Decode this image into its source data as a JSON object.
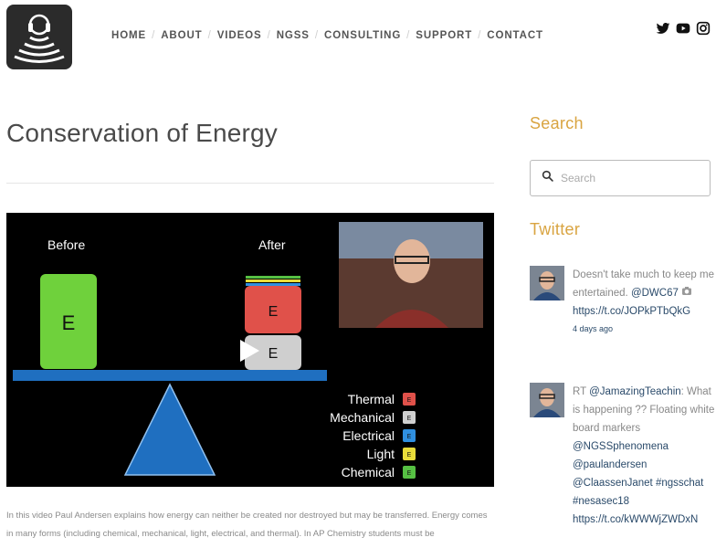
{
  "header": {
    "nav": [
      {
        "label": "HOME"
      },
      {
        "label": "ABOUT"
      },
      {
        "label": "VIDEOS"
      },
      {
        "label": "NGSS"
      },
      {
        "label": "CONSULTING"
      },
      {
        "label": "SUPPORT"
      },
      {
        "label": "CONTACT"
      }
    ],
    "social": [
      "twitter-icon",
      "youtube-icon",
      "instagram-icon"
    ]
  },
  "main": {
    "title": "Conservation of Energy",
    "video": {
      "before_label": "Before",
      "after_label": "After",
      "box_letter": "E",
      "legend": [
        {
          "label": "Thermal",
          "color": "#e0514a"
        },
        {
          "label": "Mechanical",
          "color": "#cfcfcf"
        },
        {
          "label": "Electrical",
          "color": "#2f8fe0"
        },
        {
          "label": "Light",
          "color": "#e8dc3a"
        },
        {
          "label": "Chemical",
          "color": "#56c043"
        }
      ]
    },
    "description": "In this video Paul Andersen explains how energy can neither be created nor destroyed but may be transferred. Energy comes in many forms (including chemical, mechanical, light, electrical, and thermal). In AP Chemistry students must be"
  },
  "sidebar": {
    "search_heading": "Search",
    "search_placeholder": "Search",
    "twitter_heading": "Twitter",
    "tweets": [
      {
        "text": "Doesn't take much to keep me entertained. ",
        "mention": "@DWC67",
        "link": "https://t.co/JOPkPTbQkG",
        "time": "4 days ago"
      },
      {
        "prefix": "RT ",
        "mention": "@JamazingTeachin",
        "text": ": What is happening ?? Floating white board markers",
        "mention2": "@NGSSphenomena",
        "mention3": "@paulandersen",
        "mention4": "@ClaassenJanet",
        "hashtag": "#ngsschat",
        "hashtag2": "#nesasec18",
        "link": "https://t.co/kWWWjZWDxN"
      }
    ]
  }
}
